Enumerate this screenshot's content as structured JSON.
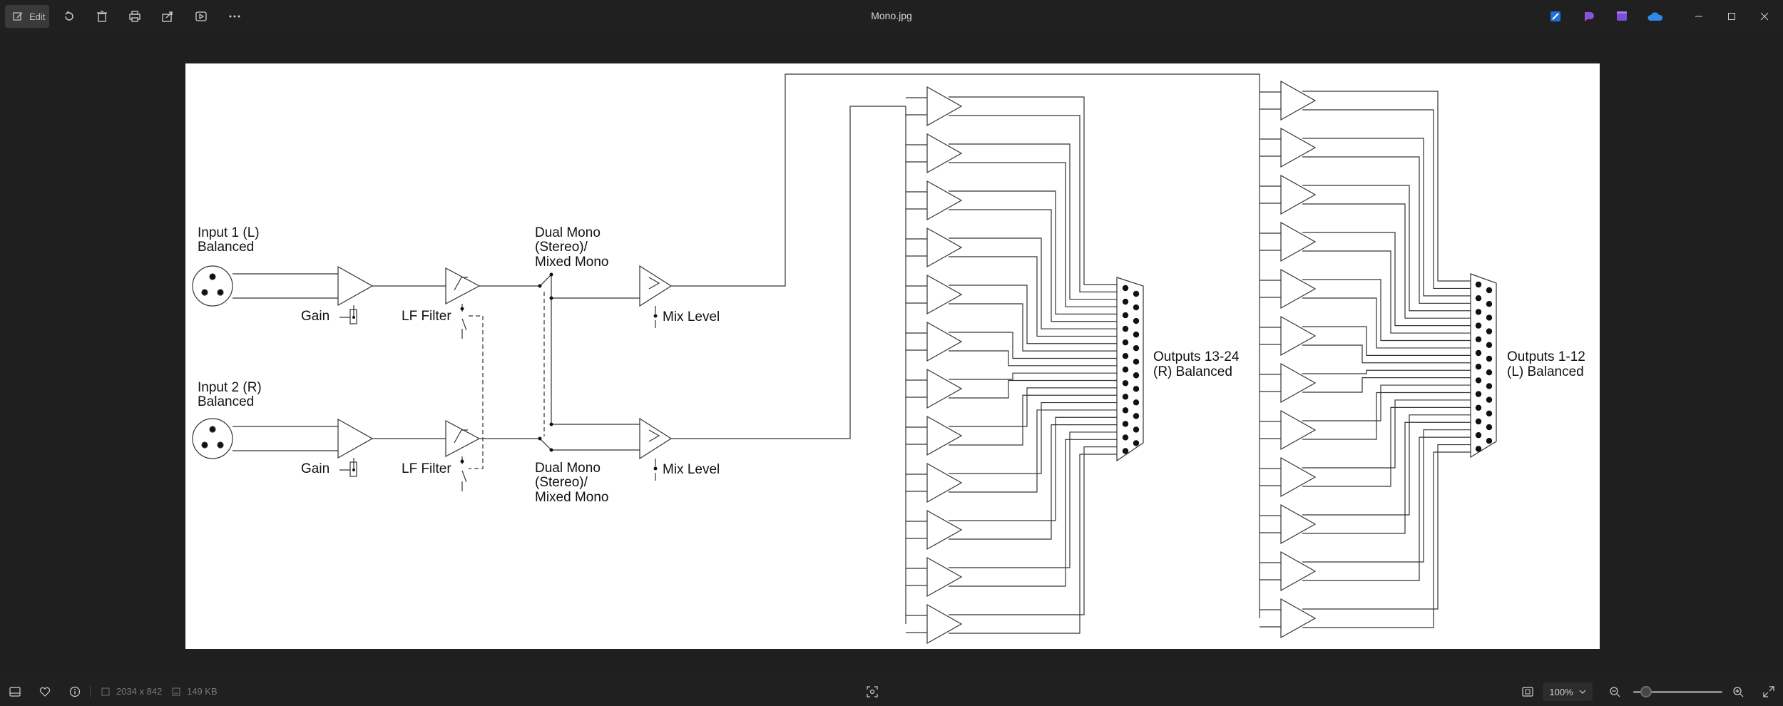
{
  "toolbar": {
    "edit_label": "Edit",
    "file_title": "Mono.jpg"
  },
  "diagram": {
    "input1_line1": "Input 1 (L)",
    "input1_line2": "Balanced",
    "input2_line1": "Input 2 (R)",
    "input2_line2": "Balanced",
    "gain_label": "Gain",
    "lf_filter_label": "LF Filter",
    "mode_line1": "Dual Mono",
    "mode_line2": "(Stereo)/",
    "mode_line3": "Mixed Mono",
    "mix_level_label": "Mix Level",
    "outputs_r_line1": "Outputs 13-24",
    "outputs_r_line2": "(R) Balanced",
    "outputs_l_line1": "Outputs 1-12",
    "outputs_l_line2": "(L) Balanced"
  },
  "statusbar": {
    "dimensions": "2034 x 842",
    "file_size": "149 KB",
    "zoom": "100%"
  }
}
